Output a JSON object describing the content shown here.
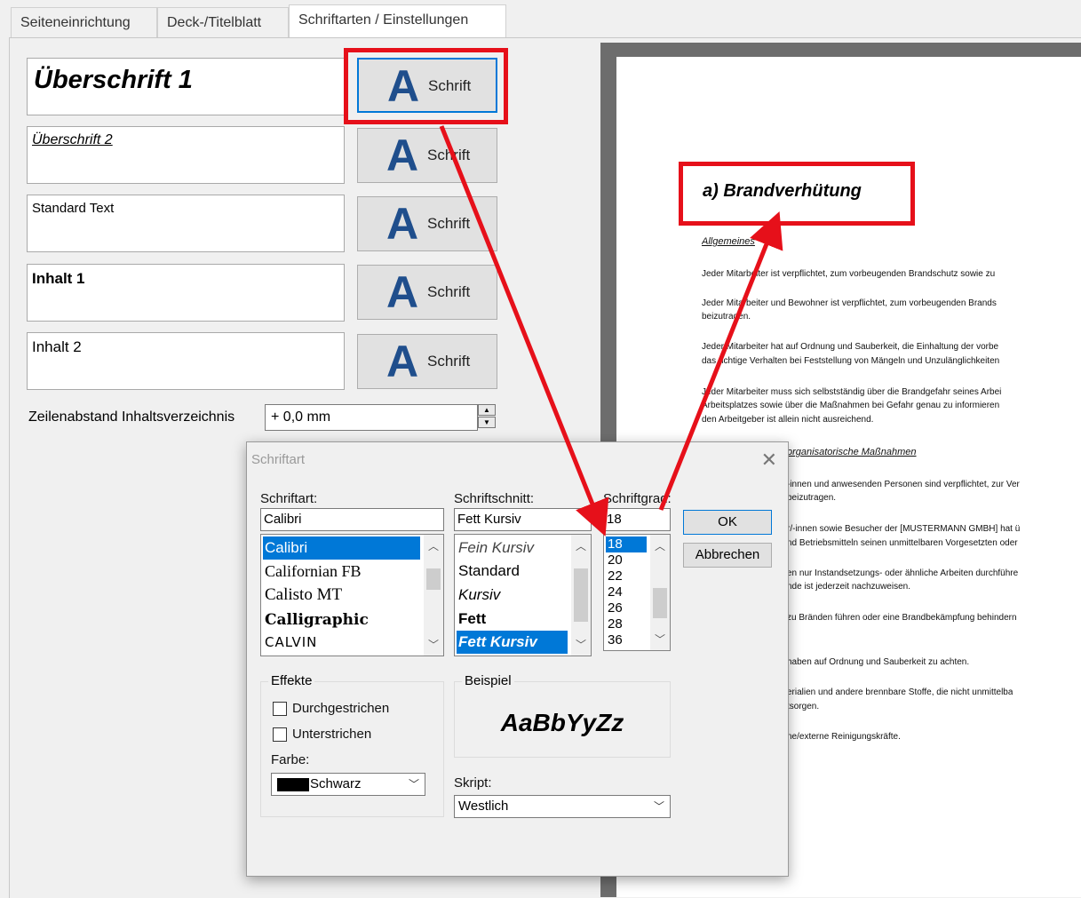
{
  "tabs": [
    "Seiteneinrichtung",
    "Deck-/Titelblatt",
    "Schriftarten / Einstellungen"
  ],
  "styles": [
    {
      "label": "Überschrift 1"
    },
    {
      "label": "Überschrift 2"
    },
    {
      "label": "Standard Text"
    },
    {
      "label": "Inhalt 1"
    },
    {
      "label": "Inhalt 2"
    }
  ],
  "font_button": {
    "glyph": "A",
    "label": "Schrift"
  },
  "line_spacing": {
    "label": "Zeilenabstand Inhaltsverzeichnis",
    "value": "+ 0,0 mm"
  },
  "preview": {
    "heading": "a) Brandverhütung",
    "subheading": "Allgemeines",
    "lines": [
      "Jeder Mitarbeiter ist verpflichtet, zum vorbeugenden Brandschutz sowie zu",
      "Jeder Mitarbeiter und Bewohner ist verpflichtet, zum vorbeugenden Brands",
      "beizutragen.",
      "Jeder Mitarbeiter hat auf Ordnung und Sauberkeit, die Einhaltung der vorbe",
      "das richtige Verhalten bei Feststellung von Mängeln und Unzulänglichkeiten",
      "Jeder Mitarbeiter muss sich selbstständig über die Brandgefahr seines Arbei",
      "Arbeitsplatzes sowie über die Maßnahmen bei Gefahr genau zu informieren",
      "den Arbeitgeber ist allein nicht ausreichend."
    ],
    "section2": "organisatorische Maßnahmen",
    "lines2": [
      "-innen und anwesenden Personen sind verpflichtet, zur Ver",
      "beizutragen.",
      "r/-innen sowie Besucher der [MUSTERMANN GMBH] hat ü",
      "nd Betriebsmitteln seinen unmittelbaren Vorgesetzten oder",
      "en nur Instandsetzungs- oder ähnliche Arbeiten durchführe",
      "nde ist jederzeit nachzuweisen.",
      "zu Bränden führen oder eine Brandbekämpfung behindern",
      "haben auf Ordnung und Sauberkeit zu achten.",
      "erialien und andere brennbare Stoffe, die nicht unmittelba",
      "tsorgen.",
      "ne/externe Reinigungskräfte."
    ]
  },
  "dialog": {
    "title": "Schriftart",
    "font_label": "Schriftart:",
    "font_value": "Calibri",
    "fonts": [
      "Calibri",
      "Californian FB",
      "Calisto MT",
      "Calligraphic",
      "CALVIN"
    ],
    "style_label": "Schriftschnitt:",
    "style_value": "Fett Kursiv",
    "styles": [
      "Fein Kursiv",
      "Standard",
      "Kursiv",
      "Fett",
      "Fett Kursiv"
    ],
    "size_label": "Schriftgrad:",
    "size_value": "18",
    "sizes": [
      "18",
      "20",
      "22",
      "24",
      "26",
      "28",
      "36"
    ],
    "ok": "OK",
    "cancel": "Abbrechen",
    "effects_title": "Effekte",
    "strike": "Durchgestrichen",
    "underline": "Unterstrichen",
    "color_label": "Farbe:",
    "color_value": "Schwarz",
    "sample_title": "Beispiel",
    "sample_text": "AaBbYyZz",
    "script_label": "Skript:",
    "script_value": "Westlich"
  },
  "colors": {
    "highlight": "#e6101a",
    "accent": "#1f4e8c",
    "selection": "#0078d7"
  }
}
